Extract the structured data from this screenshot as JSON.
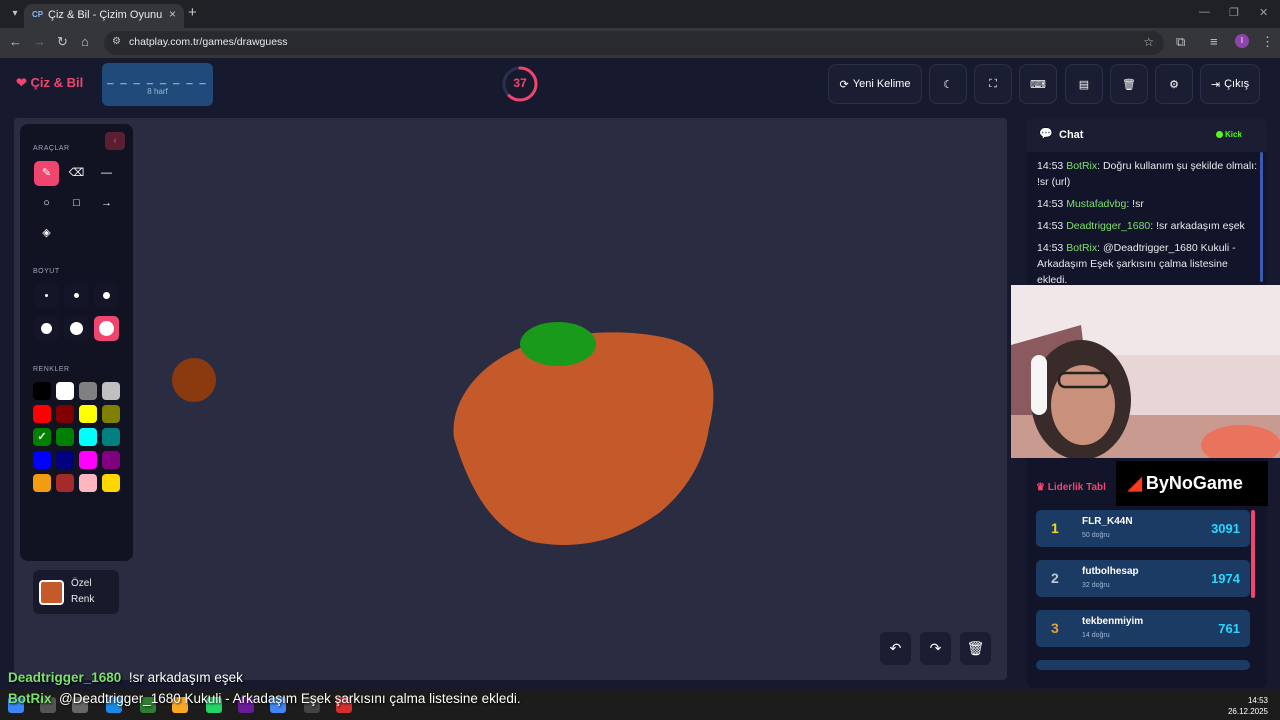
{
  "browser": {
    "tab_title": "Çiz & Bil - Çizim Oyunu",
    "tab_favicon": "CP",
    "url": "chatplay.com.tr/games/drawguess",
    "profile_initial": "I"
  },
  "header": {
    "logo": "Çiz & Bil",
    "word_mask": "_ _ _ _ _ _ _ _",
    "word_hint": "8 harf",
    "timer": "37",
    "timer_fraction": 0.62,
    "buttons": {
      "new_word": "Yeni Kelime",
      "exit": "Çıkış"
    }
  },
  "tools": {
    "tools_title": "ARAÇLAR",
    "size_title": "BOYUT",
    "colors_title": "RENKLER",
    "custom_color_line1": "Özel",
    "custom_color_line2": "Renk",
    "selected_tool": "brush",
    "selected_size_index": 5,
    "selected_color": "#00ff00",
    "custom_color": "#c4592a",
    "palette": [
      "#000000",
      "#ffffff",
      "#808080",
      "#c0c0c0",
      "#ff0000",
      "#800000",
      "#ffff00",
      "#808000",
      "#00ff00",
      "#008000",
      "#00ffff",
      "#008080",
      "#0000ff",
      "#000080",
      "#ff00ff",
      "#800080",
      "#f39c12",
      "#a52a2a",
      "#ffb6c1",
      "#ffd700"
    ]
  },
  "canvas": {
    "background": "#2a2c42",
    "stroke_colors": [
      "#c4592a",
      "#8b3a0f",
      "#1a9a1a"
    ]
  },
  "chat": {
    "title": "Chat",
    "platform_badge": "Kick",
    "messages": [
      {
        "time": "14:53",
        "user": "BotRix",
        "text": ": Doğru kullanım şu şekilde olmalı: !sr (url)"
      },
      {
        "time": "14:53",
        "user": "Mustafadvbg",
        "text": ": !sr"
      },
      {
        "time": "14:53",
        "user": "Deadtrigger_1680",
        "text": ": !sr arkadaşım eşek"
      },
      {
        "time": "14:53",
        "user": "BotRix",
        "text": ": @Deadtrigger_1680 Kukuli - Arkadaşım Eşek şarkısını çalma listesine ekledi."
      }
    ]
  },
  "leaderboard": {
    "title": "Liderlik Tabl",
    "rows": [
      {
        "rank": "1",
        "name": "FLR_K44N",
        "sub": "50 doğru",
        "score": "3091",
        "rank_color": "#ffd700"
      },
      {
        "rank": "2",
        "name": "futbolhesap",
        "sub": "32 doğru",
        "score": "1974",
        "rank_color": "#c0c8d8"
      },
      {
        "rank": "3",
        "name": "tekbenmiyim",
        "sub": "14 doğru",
        "score": "761",
        "rank_color": "#e0a040"
      }
    ]
  },
  "sponsor": {
    "name": "ByNoGame"
  },
  "overlay": {
    "line1_user": "Deadtrigger_1680",
    "line1_text": "!sr arkadaşım eşek",
    "line2_user": "BotRix",
    "line2_text": "@Deadtrigger_1680 Kukuli - Arkadaşım Eşek şarkısını çalma listesine ekledi."
  },
  "taskbar": {
    "time": "14:53",
    "date": "26.12.2025"
  }
}
